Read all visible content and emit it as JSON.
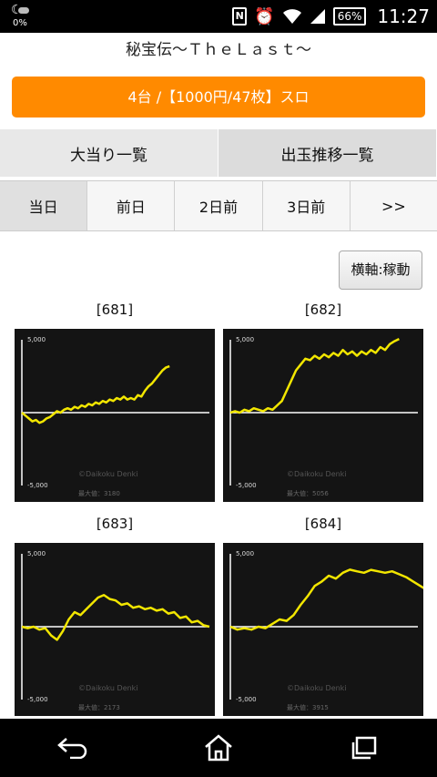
{
  "status_bar": {
    "battery_left": "0%",
    "nfc": "N",
    "battery": "66%",
    "time": "11:27"
  },
  "header": {
    "title": "秘宝伝～ＴｈｅＬａｓｔ～",
    "banner": "4台 /【1000円/47枚】スロ"
  },
  "main_tabs": [
    {
      "label": "大当り一覧"
    },
    {
      "label": "出玉推移一覧"
    }
  ],
  "day_tabs": [
    {
      "label": "当日"
    },
    {
      "label": "前日"
    },
    {
      "label": "2日前"
    },
    {
      "label": "3日前"
    },
    {
      "label": ">>"
    }
  ],
  "axis_toggle": "横軸:稼動",
  "graphs": [
    {
      "machine": "[681]",
      "y_top": "5,000",
      "y_bottom": "-5,000",
      "watermark": "©Daikoku Denki",
      "max_label": "最大値：3180",
      "chart_data": {
        "type": "line",
        "ylim": [
          -5000,
          5000
        ],
        "x": [
          0,
          3,
          6,
          9,
          12,
          15,
          18,
          21,
          24,
          27,
          30,
          33,
          36,
          39,
          42,
          45,
          48,
          51,
          54,
          57,
          60,
          63,
          66,
          69,
          72,
          75,
          78,
          81,
          84,
          87,
          90,
          93,
          96,
          99,
          102,
          105,
          108,
          111,
          114,
          117,
          120,
          123,
          126
        ],
        "y": [
          0,
          -200,
          -400,
          -600,
          -500,
          -700,
          -600,
          -400,
          -300,
          -100,
          100,
          0,
          200,
          300,
          200,
          400,
          300,
          500,
          400,
          600,
          500,
          700,
          600,
          800,
          700,
          900,
          800,
          1000,
          900,
          1100,
          900,
          1000,
          900,
          1200,
          1100,
          1500,
          1800,
          2000,
          2300,
          2600,
          2900,
          3100,
          3180
        ]
      }
    },
    {
      "machine": "[682]",
      "y_top": "5,000",
      "y_bottom": "-5,000",
      "watermark": "©Daikoku Denki",
      "max_label": "最大値：5056",
      "chart_data": {
        "type": "line",
        "ylim": [
          -5000,
          5000
        ],
        "x": [
          0,
          4,
          8,
          12,
          16,
          20,
          24,
          28,
          32,
          36,
          40,
          44,
          48,
          52,
          56,
          60,
          64,
          68,
          72,
          76,
          80,
          84,
          88,
          92,
          96,
          100,
          104,
          108,
          112,
          116,
          120,
          124,
          128,
          132,
          136,
          140,
          144
        ],
        "y": [
          0,
          100,
          0,
          200,
          100,
          300,
          200,
          100,
          300,
          200,
          500,
          800,
          1500,
          2200,
          2900,
          3300,
          3700,
          3600,
          3900,
          3700,
          4000,
          3800,
          4100,
          3900,
          4300,
          4000,
          4200,
          3900,
          4200,
          4000,
          4300,
          4100,
          4500,
          4300,
          4700,
          4900,
          5056
        ]
      }
    },
    {
      "machine": "[683]",
      "y_top": "5,000",
      "y_bottom": "-5,000",
      "watermark": "©Daikoku Denki",
      "max_label": "最大値：2173",
      "chart_data": {
        "type": "line",
        "ylim": [
          -5000,
          5000
        ],
        "x": [
          0,
          5,
          10,
          15,
          20,
          25,
          30,
          35,
          40,
          45,
          50,
          55,
          60,
          65,
          70,
          75,
          80,
          85,
          90,
          95,
          100,
          105,
          110,
          115,
          120,
          125,
          130,
          135,
          140,
          145,
          150,
          155,
          160
        ],
        "y": [
          0,
          -100,
          0,
          -200,
          -100,
          -600,
          -900,
          -300,
          500,
          1000,
          800,
          1200,
          1600,
          2000,
          2173,
          1900,
          1800,
          1500,
          1600,
          1300,
          1400,
          1200,
          1300,
          1100,
          1200,
          900,
          1000,
          600,
          700,
          300,
          400,
          100,
          0
        ]
      }
    },
    {
      "machine": "[684]",
      "y_top": "5,000",
      "y_bottom": "-5,000",
      "watermark": "©Daikoku Denki",
      "max_label": "最大値：3915",
      "chart_data": {
        "type": "line",
        "ylim": [
          -5000,
          5000
        ],
        "x": [
          0,
          6,
          12,
          18,
          24,
          30,
          36,
          42,
          48,
          54,
          60,
          66,
          72,
          78,
          84,
          90,
          96,
          102,
          108,
          114,
          120,
          126,
          132,
          138,
          144,
          150,
          156,
          162,
          168,
          174,
          180
        ],
        "y": [
          0,
          -200,
          -100,
          -200,
          0,
          -100,
          200,
          500,
          400,
          800,
          1500,
          2100,
          2800,
          3100,
          3500,
          3300,
          3700,
          3915,
          3800,
          3700,
          3900,
          3800,
          3700,
          3800,
          3600,
          3400,
          3100,
          2800,
          2500,
          2100,
          1900
        ]
      }
    }
  ],
  "nav": {
    "back": "back-icon",
    "home": "home-icon",
    "recents": "recents-icon"
  }
}
